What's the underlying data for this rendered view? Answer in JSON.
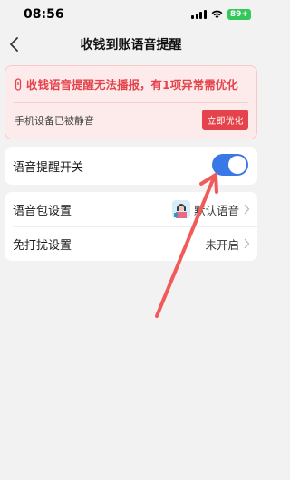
{
  "status_bar": {
    "time": "08:56",
    "battery": "89+"
  },
  "nav": {
    "title": "收钱到账语音提醒"
  },
  "alert": {
    "title": "收钱语音提醒无法播报，有1项异常需优化",
    "issue": "手机设备已被静音",
    "button": "立即优化"
  },
  "toggle_row": {
    "label": "语音提醒开关",
    "enabled": true
  },
  "settings": {
    "voice_pack": {
      "label": "语音包设置",
      "value": "默认语音"
    },
    "dnd": {
      "label": "免打扰设置",
      "value": "未开启"
    }
  },
  "colors": {
    "alert_red": "#e5434b",
    "toggle_on": "#3a78e7",
    "annotation_arrow": "#f25a5a"
  }
}
